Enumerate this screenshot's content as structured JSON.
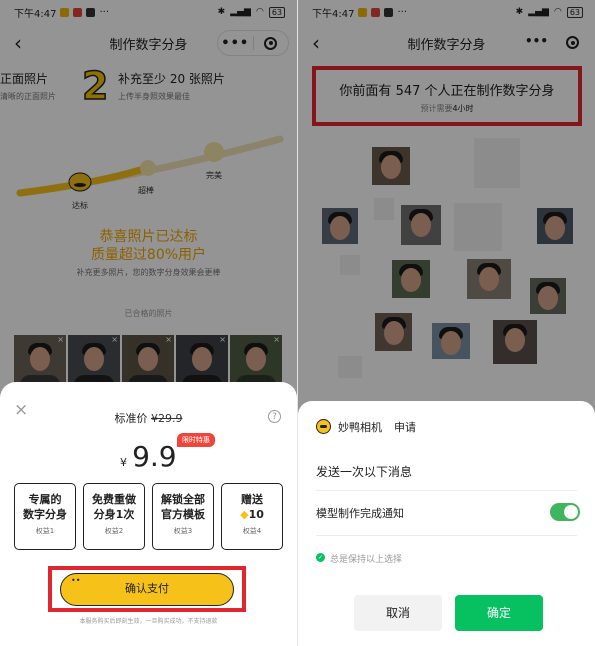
{
  "colors": {
    "brand_yellow": "#f6c21a",
    "highlight_red": "#e0262e",
    "wechat_green": "#07c160",
    "promo_tag_red": "#f0453a"
  },
  "status_bar": {
    "time": "下午4:47",
    "dots": "···",
    "right_icons": [
      "bluetooth-icon",
      "signal-icon",
      "wifi-icon"
    ],
    "battery": "63"
  },
  "left": {
    "nav": {
      "back_icon": "chevron-left-icon",
      "title": "制作数字分身",
      "more": "•••",
      "close_icon": "target-close-icon"
    },
    "step1": {
      "title": "正面照片",
      "sub": "清晰的正面照片"
    },
    "step2": {
      "number": "2",
      "title": "补充至少 20 张照片",
      "sub": "上传半身照效果最佳"
    },
    "levels": [
      "达标",
      "超棒",
      "完美"
    ],
    "congrats_line1": "恭喜照片已达标",
    "congrats_line2": "质量超过80%用户",
    "congrats_sub": "补充更多照片，您的数字分身效果会更棒",
    "qualified_label": "已合格的照片",
    "thumb_remove": "×",
    "sheet": {
      "close": "×",
      "original_label": "标准价",
      "original_price": "¥29.9",
      "help": "?",
      "currency": "¥",
      "price": "9.9",
      "promo_tag": "限时特惠",
      "benefits": [
        {
          "line1": "专属的",
          "line2": "数字分身",
          "sub": "权益1"
        },
        {
          "line1": "免费重做",
          "line2": "分身1次",
          "sub": "权益2"
        },
        {
          "line1": "解锁全部",
          "line2": "官方模板",
          "sub": "权益3"
        },
        {
          "line1": "赠送",
          "line2": "10",
          "sub": "权益4"
        }
      ],
      "pay_button": "确认支付",
      "disclaimer": "本服务购买后即刻生效，一旦购买成功，不支持退款"
    }
  },
  "right": {
    "nav": {
      "back_icon": "chevron-left-icon",
      "title": "制作数字分身",
      "more": "•••",
      "close_icon": "target-close-icon"
    },
    "queue_prefix": "你前面有",
    "queue_count": "547",
    "queue_suffix": "个人正在制作数字分身",
    "eta_prefix": "预计需要",
    "eta_value": "4小时",
    "dialog": {
      "app_name": "妙鸭相机",
      "request": "申请",
      "title": "发送一次以下消息",
      "item": "模型制作完成通知",
      "toggle_on": true,
      "always_keep": "总是保持以上选择",
      "cancel": "取消",
      "confirm": "确定"
    }
  }
}
